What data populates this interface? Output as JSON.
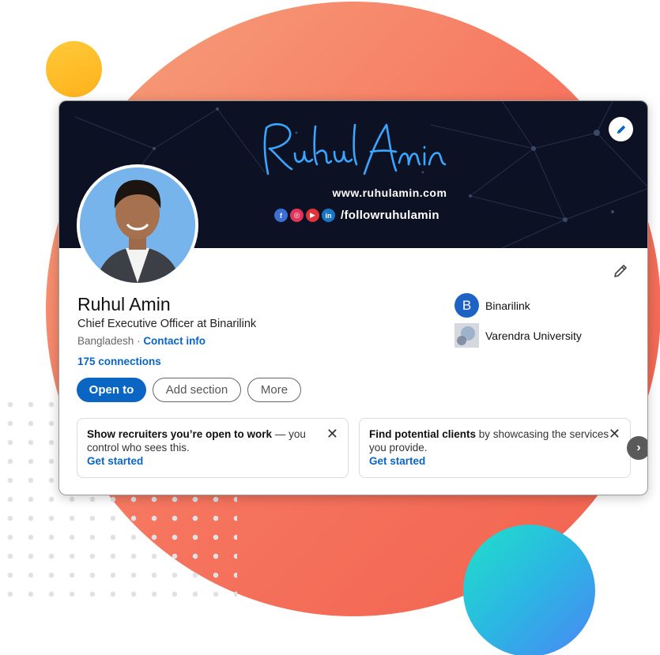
{
  "banner": {
    "signature": "Ruhul Amin",
    "website": "www.ruhulamin.com",
    "social_icons": [
      "facebook-icon",
      "instagram-icon",
      "youtube-icon",
      "linkedin-icon"
    ],
    "social_glyphs": [
      "f",
      "◎",
      "▶",
      "in"
    ],
    "handle": "/followruhulamin"
  },
  "profile": {
    "name": "Ruhul Amin",
    "headline": "Chief Executive Officer at Binarilink",
    "location": "Bangladesh",
    "separator": " · ",
    "contact_info": "Contact info",
    "connections": "175 connections"
  },
  "actions": {
    "open_to": "Open to",
    "add_section": "Add section",
    "more": "More"
  },
  "organizations": {
    "company": {
      "logo_letter": "B",
      "name": "Binarilink"
    },
    "school": {
      "name": "Varendra University"
    }
  },
  "suggestions": [
    {
      "bold": "Show recruiters you’re open to work",
      "rest": " — you control who sees this.",
      "cta": "Get started"
    },
    {
      "bold": "Find potential clients",
      "rest": " by showcasing the services you provide.",
      "cta": "Get started"
    }
  ],
  "colors": {
    "accent": "#0a66c2",
    "banner_bg": "#0c1224",
    "signature": "#3aa6ff",
    "bg_circle": "#f6765f",
    "yellow_dot": "#ffbd2a",
    "teal_circle": "#2bb7e3"
  }
}
